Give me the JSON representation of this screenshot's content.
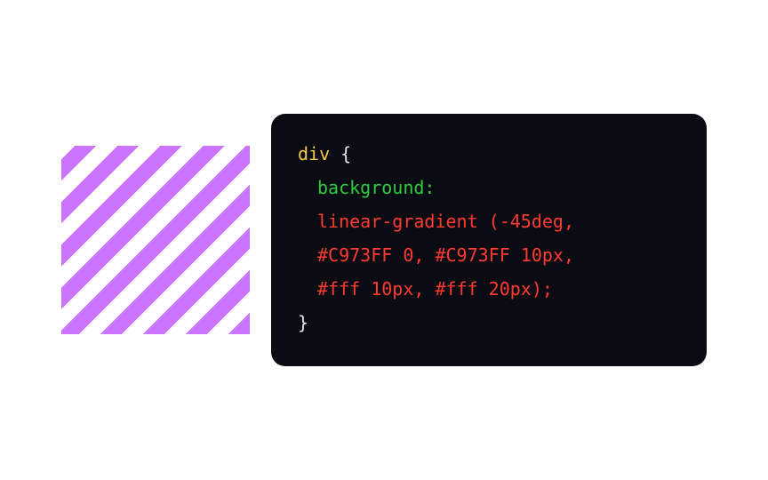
{
  "stripe_color": "#C973FF",
  "stripe_bg": "#ffffff",
  "code": {
    "selector": "div",
    "open_brace": " {",
    "property": "background",
    "colon": ":",
    "value_line1": "linear-gradient (-45deg,",
    "value_line2": "#C973FF 0, #C973FF 10px,",
    "value_line3": "#fff 10px, #fff 20px);",
    "close_brace": "}"
  }
}
